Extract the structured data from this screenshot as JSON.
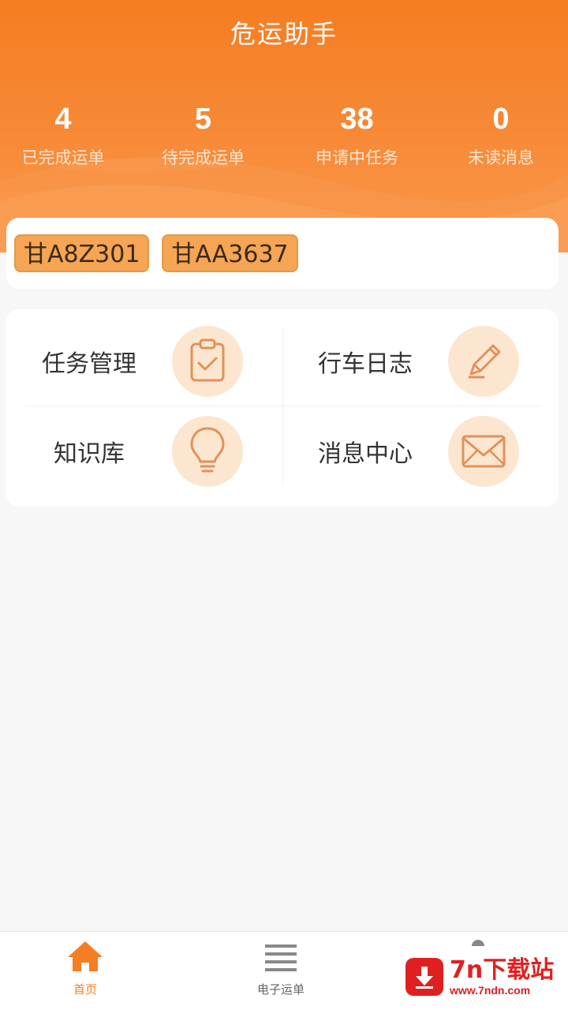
{
  "header": {
    "title": "危运助手",
    "stats": [
      {
        "value": "4",
        "label": "已完成运单"
      },
      {
        "value": "5",
        "label": "待完成运单"
      },
      {
        "value": "38",
        "label": "申请中任务"
      },
      {
        "value": "0",
        "label": "未读消息"
      }
    ]
  },
  "plates": [
    "甘A8Z301",
    "甘AA3637"
  ],
  "grid": {
    "items": [
      {
        "label": "任务管理",
        "icon": "clipboard-check-icon"
      },
      {
        "label": "行车日志",
        "icon": "pencil-icon"
      },
      {
        "label": "知识库",
        "icon": "lightbulb-icon"
      },
      {
        "label": "消息中心",
        "icon": "envelope-icon"
      }
    ]
  },
  "bottom_nav": {
    "items": [
      {
        "label": "首页",
        "icon": "home-icon",
        "active": true
      },
      {
        "label": "电子运单",
        "icon": "list-icon",
        "active": false
      }
    ]
  },
  "watermark": {
    "brand": "7n下载站",
    "url": "www.7ndn.com"
  },
  "colors": {
    "accent": "#f57d22",
    "icon_bg": "#fde6cf",
    "plate_bg": "#f5a553"
  }
}
